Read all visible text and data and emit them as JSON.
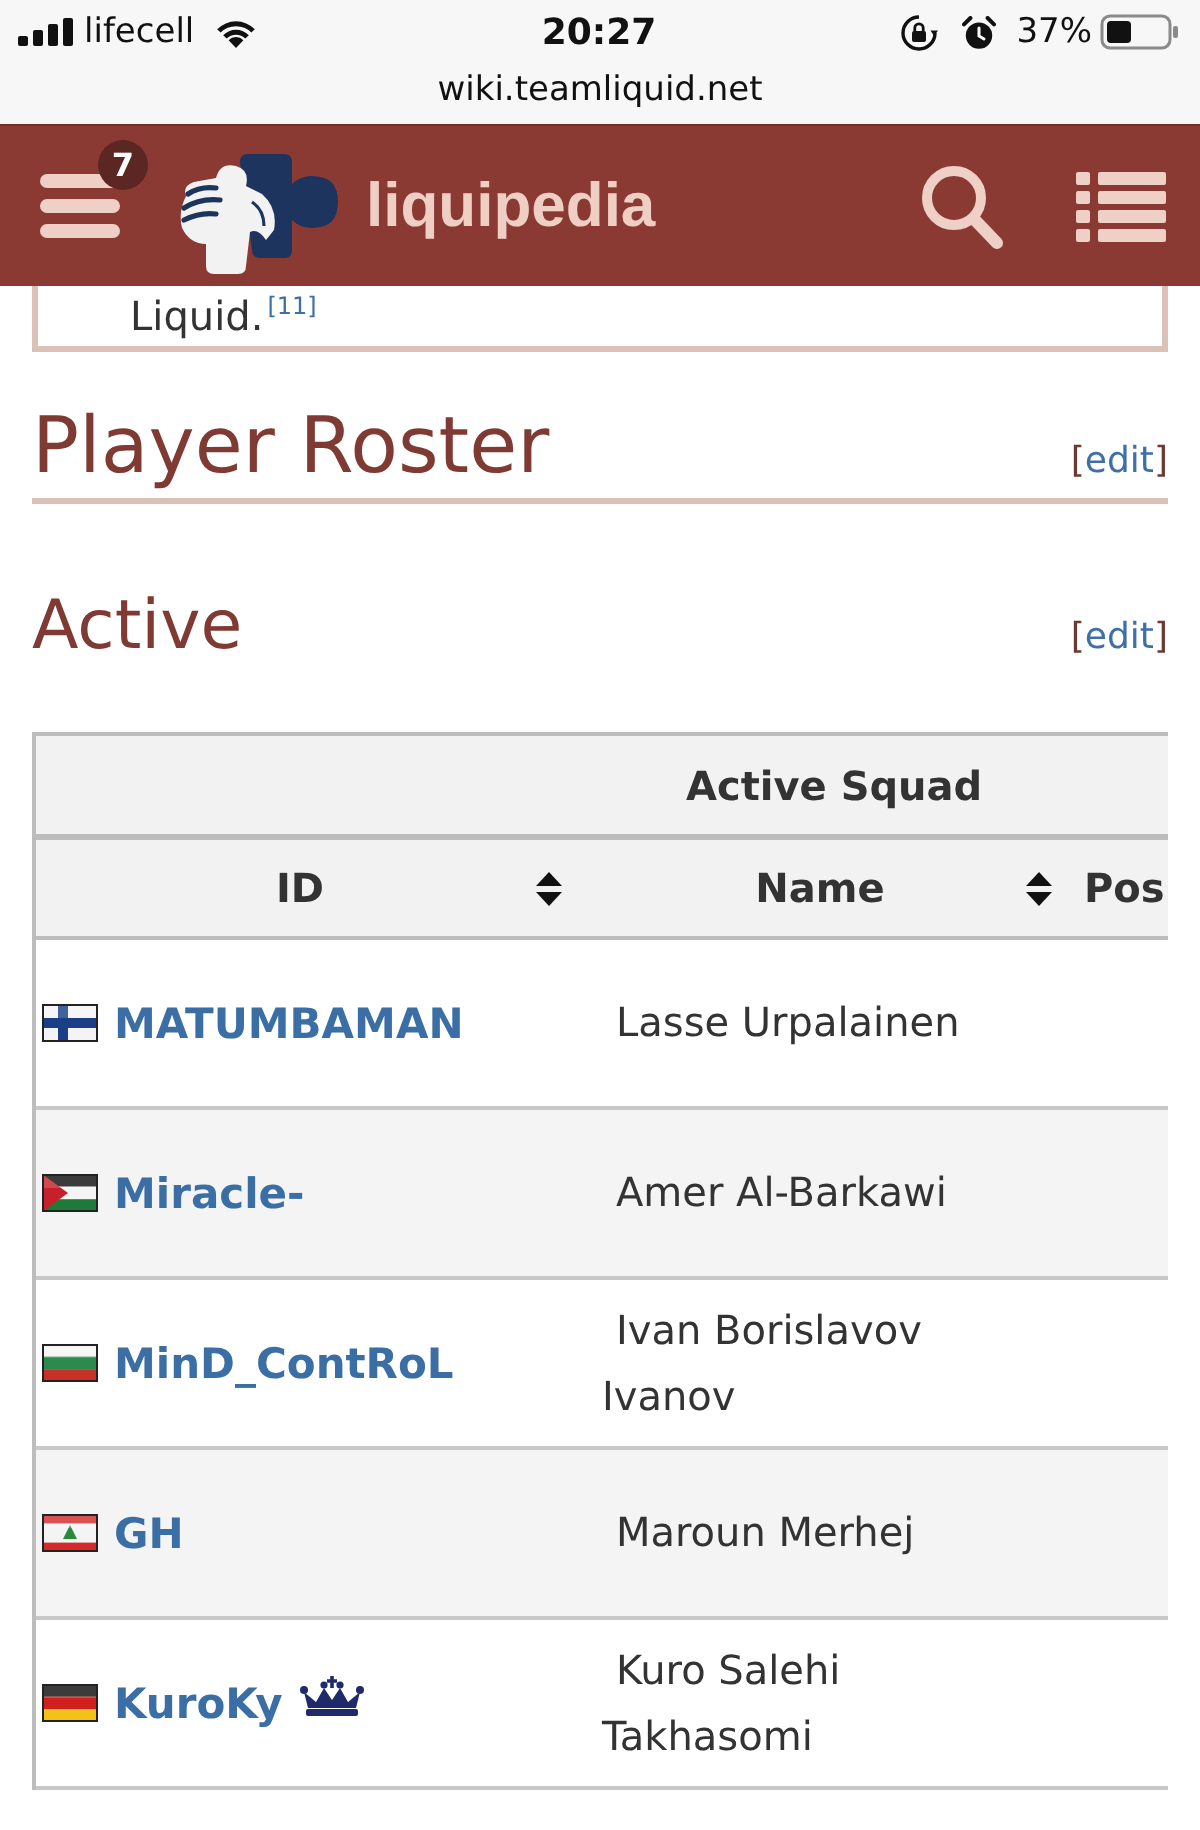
{
  "status_bar": {
    "carrier": "lifecell",
    "time": "20:27",
    "battery": "37%"
  },
  "address_bar": {
    "url": "wiki.teamliquid.net"
  },
  "header": {
    "notification_count": "7",
    "logo_text": "liquipedia"
  },
  "intro_box": {
    "text": "Liquid.",
    "reference": "[11]"
  },
  "sections": [
    {
      "kind": "heading",
      "title": "Player Roster",
      "edit_link": {
        "open": "[",
        "label": "edit",
        "close": "]"
      }
    },
    {
      "kind": "subheading",
      "title": "Active",
      "edit_link": {
        "open": "[",
        "label": "edit",
        "close": "]"
      }
    }
  ],
  "table": {
    "group_header": "Active Squad",
    "columns": [
      {
        "label": "ID",
        "sortable": true
      },
      {
        "label": "Name",
        "sortable": true
      },
      {
        "label": "Pos",
        "sortable": false
      }
    ],
    "rows": [
      {
        "flag": {
          "kind": "finland"
        },
        "id": "MATUMBAMAN",
        "name": "Lasse Urpalainen",
        "captain": false
      },
      {
        "flag": {
          "kind": "jordan"
        },
        "id": "Miracle-",
        "name": "Amer Al-Barkawi",
        "captain": false
      },
      {
        "flag": {
          "kind": "bulgaria"
        },
        "id": "MinD_ContRoL",
        "name": "Ivan Borislavov Ivanov",
        "captain": false
      },
      {
        "flag": {
          "kind": "lebanon"
        },
        "id": "GH",
        "name": "Maroun Merhej",
        "captain": false
      },
      {
        "flag": {
          "kind": "germany"
        },
        "id": "KuroKy",
        "name": "Kuro Salehi Takhasomi",
        "captain": true
      }
    ]
  }
}
